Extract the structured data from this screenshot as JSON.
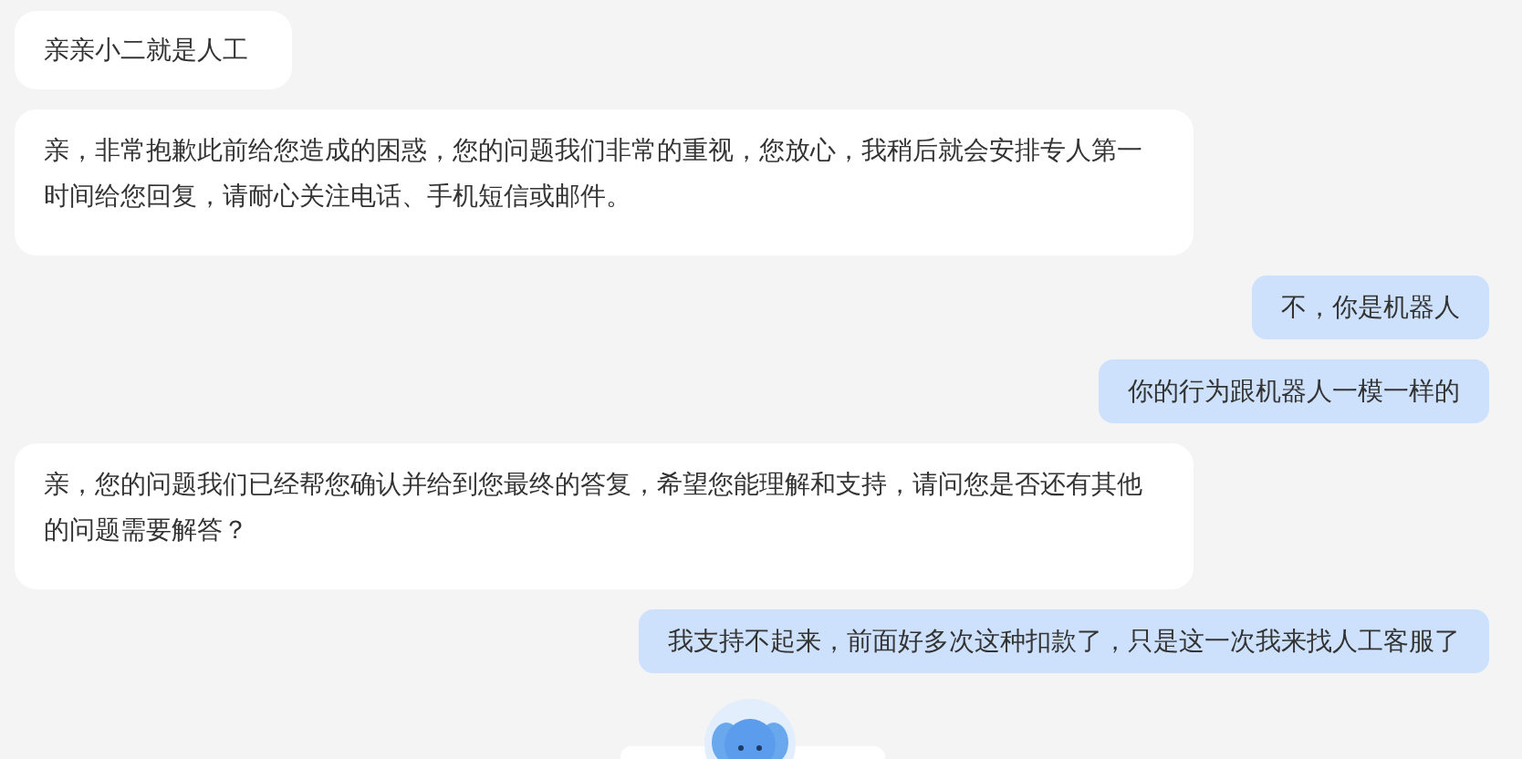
{
  "messages": [
    {
      "kind": "incoming",
      "text": "亲亲小二就是人工"
    },
    {
      "kind": "incoming",
      "text": "亲，非常抱歉此前给您造成的困惑，您的问题我们非常的重视，您放心，我稍后就会安排专人第一时间给您回复，请耐心关注电话、手机短信或邮件。"
    },
    {
      "kind": "outgoing",
      "text": "不，你是机器人"
    },
    {
      "kind": "outgoing",
      "text": "你的行为跟机器人一模一样的"
    },
    {
      "kind": "incoming",
      "text": "亲，您的问题我们已经帮您确认并给到您最终的答复，希望您能理解和支持，请问您是否还有其他的问题需要解答？"
    },
    {
      "kind": "outgoing",
      "text": "我支持不起来，前面好多次这种扣款了，只是这一次我来找人工客服了"
    }
  ]
}
